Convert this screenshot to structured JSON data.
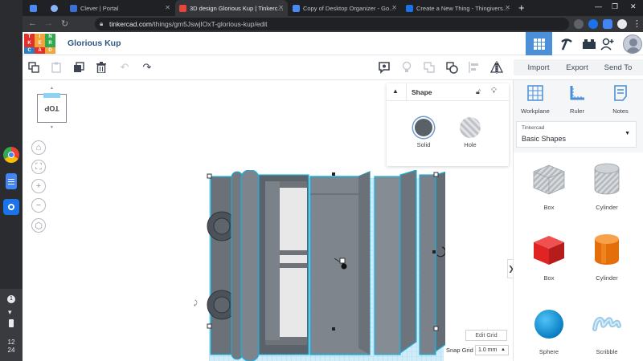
{
  "browser": {
    "tabs": [
      {
        "title": "",
        "fav": "#4a8af4"
      },
      {
        "title": "",
        "fav": "#8ab4f8"
      },
      {
        "title": "Clever | Portal",
        "fav": "#3b6fd1"
      },
      {
        "title": "3D design Glorious Kup | Tinkerc…",
        "fav": "#e8453c"
      },
      {
        "title": "Copy of Desktop Organizer - Go…",
        "fav": "#4a8af4"
      },
      {
        "title": "Create a New Thing - Thingivers…",
        "fav": "#1a73e8"
      }
    ],
    "url_host": "tinkercad.com",
    "url_path": "/things/gm5JswjIOxT-glorious-kup/edit"
  },
  "shelf": {
    "apps": [
      {
        "name": "chrome-icon",
        "color": "#fbbc04"
      },
      {
        "name": "docs-icon",
        "color": "#4285f4"
      },
      {
        "name": "camera-icon",
        "color": "#1a73e8"
      }
    ],
    "status": {
      "badge": "1",
      "time_hour": "12",
      "time_min": "24"
    }
  },
  "app": {
    "logo_letters": [
      "T",
      "I",
      "N",
      "K",
      "E",
      "R",
      "C",
      "A",
      "D"
    ],
    "logo_colors": [
      "#e32f2a",
      "#f2a43a",
      "#31a84f",
      "#e32f2a",
      "#f2a43a",
      "#31a84f",
      "#2b7ec4",
      "#e32f2a",
      "#f2a43a"
    ],
    "design_title": "Glorious Kup",
    "accent": "#4a8fd8",
    "actions": {
      "import": "Import",
      "export": "Export",
      "send_to": "Send To"
    },
    "viewcube_label": "TOP",
    "inspector": {
      "title": "Shape",
      "solid_label": "Solid",
      "hole_label": "Hole"
    },
    "grid": {
      "edit_label": "Edit Grid",
      "snap_label": "Snap Grid",
      "snap_value": "1.0 mm"
    },
    "panel": {
      "workplane": "Workplane",
      "ruler": "Ruler",
      "notes": "Notes",
      "library_category": "Tinkercad",
      "library_name": "Basic Shapes",
      "shapes": [
        {
          "label": "Box",
          "icon": "box-striped-icon"
        },
        {
          "label": "Cylinder",
          "icon": "cylinder-striped-icon"
        },
        {
          "label": "Box",
          "icon": "box-red-icon"
        },
        {
          "label": "Cylinder",
          "icon": "cylinder-orange-icon"
        },
        {
          "label": "Sphere",
          "icon": "sphere-blue-icon"
        },
        {
          "label": "Scribble",
          "icon": "scribble-icon"
        }
      ]
    }
  }
}
